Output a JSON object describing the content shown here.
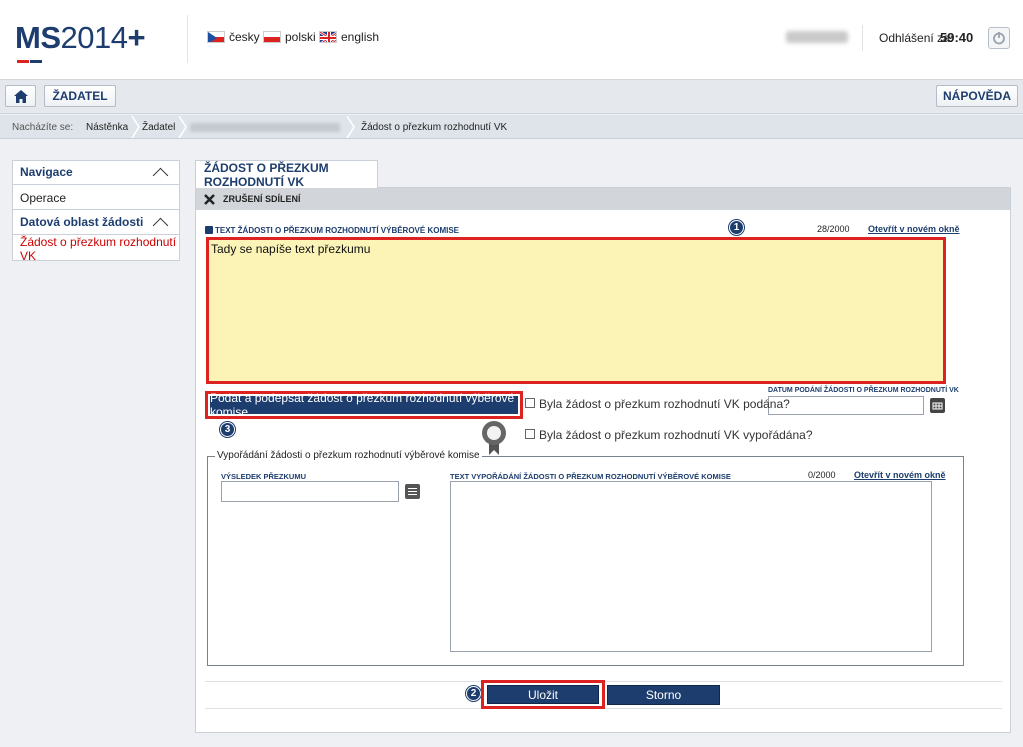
{
  "header": {
    "logo_ms": "MS",
    "logo_year": "2014",
    "logo_plus": "+",
    "languages": [
      {
        "label": "česky",
        "flag": "cz-flag-icon"
      },
      {
        "label": "polski",
        "flag": "pl-flag-icon"
      },
      {
        "label": "english",
        "flag": "uk-flag-icon"
      }
    ],
    "logout_label": "Odhlášení za:",
    "logout_time": "59:40"
  },
  "topbar": {
    "home_icon": "home-icon",
    "zadatel_label": "ŽADATEL",
    "help_label": "NÁPOVĚDA"
  },
  "breadcrumb": {
    "prefix": "Nacházíte se:",
    "items": [
      "Nástěnka",
      "Žadatel",
      "Žádost o přezkum rozhodnutí VK"
    ]
  },
  "nav": {
    "header": "Navigace",
    "items": [
      "Operace"
    ],
    "section": "Datová oblast žádosti",
    "active": "Žádost o přezkum rozhodnutí VK"
  },
  "main": {
    "tab_title": "ŽÁDOST O PŘEZKUM ROZHODNUTÍ VK",
    "share_label": "ZRUŠENÍ SDÍLENÍ",
    "text_label": "TEXT ŽÁDOSTI O PŘEZKUM ROZHODNUTÍ VÝBĚROVÉ KOMISE",
    "text_counter": "28/2000",
    "text_open_link": "Otevřít v novém okně",
    "text_value": "Tady se napíše text přezkumu",
    "date_label": "DATUM PODÁNÍ ŽÁDOSTI O PŘEZKUM ROZHODNUTÍ VK",
    "sign_button": "Podat a podepsat žádost o přezkum rozhodnutí výběrové komise",
    "check1_label": "Byla žádost o přezkum rozhodnutí VK podána?",
    "check2_label": "Byla žádost o přezkum rozhodnutí VK vypořádána?",
    "fieldset_legend": "Vypořádání žádosti o přezkum rozhodnutí výběrové komise",
    "result_label": "VÝSLEDEK PŘEZKUMU",
    "settle_label": "TEXT VYPOŘÁDÁNÍ ŽÁDOSTI O PŘEZKUM ROZHODNUTÍ VÝBĚROVÉ KOMISE",
    "settle_counter": "0/2000",
    "settle_open_link": "Otevřít v novém okně",
    "save_button": "Uložit",
    "cancel_button": "Storno",
    "badges": [
      "1",
      "2",
      "3"
    ]
  },
  "colors": {
    "brand": "#1d3d6e",
    "highlight": "#dd2222",
    "textarea_bg": "#fbf4b6"
  }
}
